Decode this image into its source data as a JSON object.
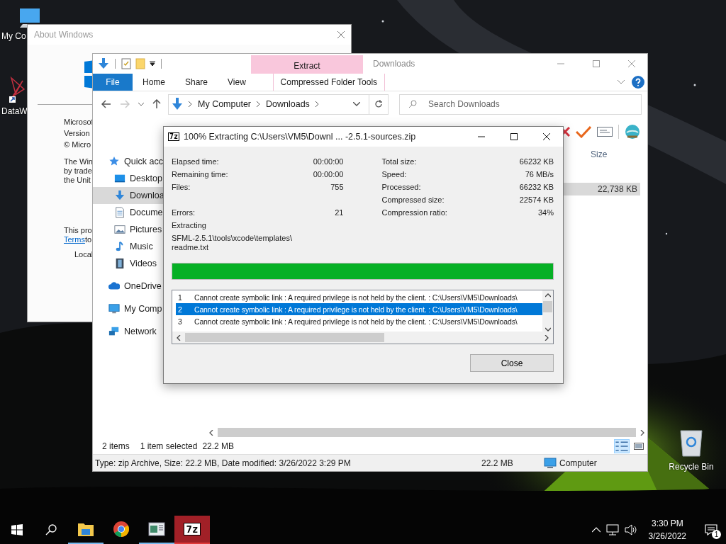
{
  "desktop": {
    "icons": [
      {
        "kind": "computer",
        "label": "My Co"
      },
      {
        "kind": "web",
        "label": "DataW"
      },
      {
        "kind": "recycle",
        "label": "Recycle Bin"
      }
    ]
  },
  "about_window": {
    "title": "About Windows",
    "lines": [
      "Microsof",
      "Version",
      "© Micro"
    ],
    "notice_lines": [
      "The Win",
      "by trade",
      "the Unit"
    ],
    "license_line": "This pro",
    "link": "Terms",
    "link_after": "to",
    "owner_line": "Local"
  },
  "explorer": {
    "title": "Downloads",
    "contextual_group": "Extract",
    "ribbon_tabs": [
      {
        "kind": "file",
        "label": "File"
      },
      {
        "kind": "tab",
        "label": "Home"
      },
      {
        "kind": "tab",
        "label": "Share"
      },
      {
        "kind": "tab",
        "label": "View"
      },
      {
        "kind": "contextual",
        "label": "Compressed Folder Tools"
      }
    ],
    "address": [
      "My Computer",
      "Downloads"
    ],
    "search": {
      "placeholder": "Search Downloads"
    },
    "nav_pane": [
      {
        "kind": "star",
        "label": "Quick acc",
        "selected": false,
        "children": [
          {
            "kind": "desktop",
            "label": "Desktop",
            "selected": false
          },
          {
            "kind": "download",
            "label": "Downloa",
            "selected": true
          },
          {
            "kind": "document",
            "label": "Docume",
            "selected": false
          },
          {
            "kind": "pictures",
            "label": "Pictures",
            "selected": false
          },
          {
            "kind": "music",
            "label": "Music",
            "selected": false
          },
          {
            "kind": "videos",
            "label": "Videos",
            "selected": false
          }
        ]
      },
      {
        "kind": "cloud",
        "label": "OneDrive",
        "selected": false
      },
      {
        "kind": "computer",
        "label": "My Comp",
        "selected": false
      },
      {
        "kind": "network",
        "label": "Network",
        "selected": false
      }
    ],
    "columns": [
      {
        "label": "Size"
      }
    ],
    "rows": [
      {
        "size": "22,738 KB",
        "selected": true
      }
    ],
    "status_bar": {
      "items": "2 items",
      "selection": "1 item selected",
      "size": "22.2 MB"
    },
    "details_bar": {
      "description": "Type: zip Archive, Size: 22.2 MB, Date modified: 3/26/2022 3:29 PM",
      "size": "22.2 MB",
      "location": "Computer"
    }
  },
  "dialog": {
    "icon_text": "7z",
    "title": "100% Extracting C:\\Users\\VM5\\Downl ... -2.5.1-sources.zip",
    "stats_left": [
      {
        "label": "Elapsed time:",
        "value": "00:00:00"
      },
      {
        "label": "Remaining time:",
        "value": "00:00:00"
      },
      {
        "label": "Files:",
        "value": "755"
      }
    ],
    "errors": {
      "label": "Errors:",
      "value": "21"
    },
    "stats_right": [
      {
        "label": "Total size:",
        "value": "66232 KB"
      },
      {
        "label": "Speed:",
        "value": "76 MB/s"
      },
      {
        "label": "Processed:",
        "value": "66232 KB"
      },
      {
        "label": "Compressed size:",
        "value": "22574 KB"
      },
      {
        "label": "Compression ratio:",
        "value": "34%"
      }
    ],
    "status": "Extracting",
    "path_lines": [
      "SFML-2.5.1\\tools\\xcode\\templates\\",
      "readme.txt"
    ],
    "progress": {
      "level": 1
    },
    "messages": [
      {
        "index": "1",
        "text": "Cannot create symbolic link : A required privilege is not held by the client. : C:\\Users\\VM5\\Downloads\\",
        "selected": false
      },
      {
        "index": "2",
        "text": "Cannot create symbolic link : A required privilege is not held by the client. : C:\\Users\\VM5\\Downloads\\",
        "selected": true
      },
      {
        "index": "3",
        "text": "Cannot create symbolic link : A required privilege is not held by the client. : C:\\Users\\VM5\\Downloads\\",
        "selected": false
      }
    ],
    "buttons": [
      "Close"
    ]
  },
  "taskbar": {
    "apps": [
      {
        "kind": "explorer",
        "running": true,
        "selected": false
      },
      {
        "kind": "chrome",
        "running": false,
        "selected": false
      },
      {
        "kind": "app",
        "running": true,
        "selected": false
      },
      {
        "kind": "sevenzip",
        "label": "7z",
        "running": true,
        "selected": true
      }
    ],
    "time": "3:30 PM",
    "date": "3/26/2022",
    "notifications": "1"
  }
}
